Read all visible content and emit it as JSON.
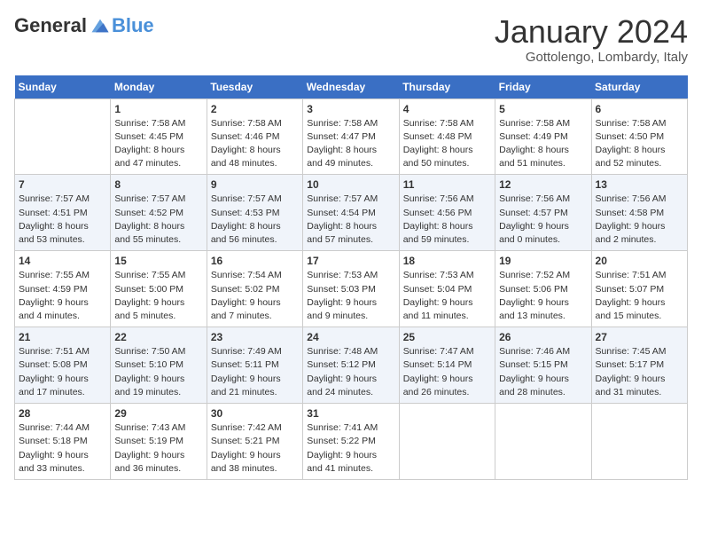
{
  "logo": {
    "general": "General",
    "blue": "Blue"
  },
  "header": {
    "month": "January 2024",
    "location": "Gottolengo, Lombardy, Italy"
  },
  "weekdays": [
    "Sunday",
    "Monday",
    "Tuesday",
    "Wednesday",
    "Thursday",
    "Friday",
    "Saturday"
  ],
  "weeks": [
    [
      {
        "day": "",
        "info": ""
      },
      {
        "day": "1",
        "info": "Sunrise: 7:58 AM\nSunset: 4:45 PM\nDaylight: 8 hours\nand 47 minutes."
      },
      {
        "day": "2",
        "info": "Sunrise: 7:58 AM\nSunset: 4:46 PM\nDaylight: 8 hours\nand 48 minutes."
      },
      {
        "day": "3",
        "info": "Sunrise: 7:58 AM\nSunset: 4:47 PM\nDaylight: 8 hours\nand 49 minutes."
      },
      {
        "day": "4",
        "info": "Sunrise: 7:58 AM\nSunset: 4:48 PM\nDaylight: 8 hours\nand 50 minutes."
      },
      {
        "day": "5",
        "info": "Sunrise: 7:58 AM\nSunset: 4:49 PM\nDaylight: 8 hours\nand 51 minutes."
      },
      {
        "day": "6",
        "info": "Sunrise: 7:58 AM\nSunset: 4:50 PM\nDaylight: 8 hours\nand 52 minutes."
      }
    ],
    [
      {
        "day": "7",
        "info": "Sunrise: 7:57 AM\nSunset: 4:51 PM\nDaylight: 8 hours\nand 53 minutes."
      },
      {
        "day": "8",
        "info": "Sunrise: 7:57 AM\nSunset: 4:52 PM\nDaylight: 8 hours\nand 55 minutes."
      },
      {
        "day": "9",
        "info": "Sunrise: 7:57 AM\nSunset: 4:53 PM\nDaylight: 8 hours\nand 56 minutes."
      },
      {
        "day": "10",
        "info": "Sunrise: 7:57 AM\nSunset: 4:54 PM\nDaylight: 8 hours\nand 57 minutes."
      },
      {
        "day": "11",
        "info": "Sunrise: 7:56 AM\nSunset: 4:56 PM\nDaylight: 8 hours\nand 59 minutes."
      },
      {
        "day": "12",
        "info": "Sunrise: 7:56 AM\nSunset: 4:57 PM\nDaylight: 9 hours\nand 0 minutes."
      },
      {
        "day": "13",
        "info": "Sunrise: 7:56 AM\nSunset: 4:58 PM\nDaylight: 9 hours\nand 2 minutes."
      }
    ],
    [
      {
        "day": "14",
        "info": "Sunrise: 7:55 AM\nSunset: 4:59 PM\nDaylight: 9 hours\nand 4 minutes."
      },
      {
        "day": "15",
        "info": "Sunrise: 7:55 AM\nSunset: 5:00 PM\nDaylight: 9 hours\nand 5 minutes."
      },
      {
        "day": "16",
        "info": "Sunrise: 7:54 AM\nSunset: 5:02 PM\nDaylight: 9 hours\nand 7 minutes."
      },
      {
        "day": "17",
        "info": "Sunrise: 7:53 AM\nSunset: 5:03 PM\nDaylight: 9 hours\nand 9 minutes."
      },
      {
        "day": "18",
        "info": "Sunrise: 7:53 AM\nSunset: 5:04 PM\nDaylight: 9 hours\nand 11 minutes."
      },
      {
        "day": "19",
        "info": "Sunrise: 7:52 AM\nSunset: 5:06 PM\nDaylight: 9 hours\nand 13 minutes."
      },
      {
        "day": "20",
        "info": "Sunrise: 7:51 AM\nSunset: 5:07 PM\nDaylight: 9 hours\nand 15 minutes."
      }
    ],
    [
      {
        "day": "21",
        "info": "Sunrise: 7:51 AM\nSunset: 5:08 PM\nDaylight: 9 hours\nand 17 minutes."
      },
      {
        "day": "22",
        "info": "Sunrise: 7:50 AM\nSunset: 5:10 PM\nDaylight: 9 hours\nand 19 minutes."
      },
      {
        "day": "23",
        "info": "Sunrise: 7:49 AM\nSunset: 5:11 PM\nDaylight: 9 hours\nand 21 minutes."
      },
      {
        "day": "24",
        "info": "Sunrise: 7:48 AM\nSunset: 5:12 PM\nDaylight: 9 hours\nand 24 minutes."
      },
      {
        "day": "25",
        "info": "Sunrise: 7:47 AM\nSunset: 5:14 PM\nDaylight: 9 hours\nand 26 minutes."
      },
      {
        "day": "26",
        "info": "Sunrise: 7:46 AM\nSunset: 5:15 PM\nDaylight: 9 hours\nand 28 minutes."
      },
      {
        "day": "27",
        "info": "Sunrise: 7:45 AM\nSunset: 5:17 PM\nDaylight: 9 hours\nand 31 minutes."
      }
    ],
    [
      {
        "day": "28",
        "info": "Sunrise: 7:44 AM\nSunset: 5:18 PM\nDaylight: 9 hours\nand 33 minutes."
      },
      {
        "day": "29",
        "info": "Sunrise: 7:43 AM\nSunset: 5:19 PM\nDaylight: 9 hours\nand 36 minutes."
      },
      {
        "day": "30",
        "info": "Sunrise: 7:42 AM\nSunset: 5:21 PM\nDaylight: 9 hours\nand 38 minutes."
      },
      {
        "day": "31",
        "info": "Sunrise: 7:41 AM\nSunset: 5:22 PM\nDaylight: 9 hours\nand 41 minutes."
      },
      {
        "day": "",
        "info": ""
      },
      {
        "day": "",
        "info": ""
      },
      {
        "day": "",
        "info": ""
      }
    ]
  ]
}
